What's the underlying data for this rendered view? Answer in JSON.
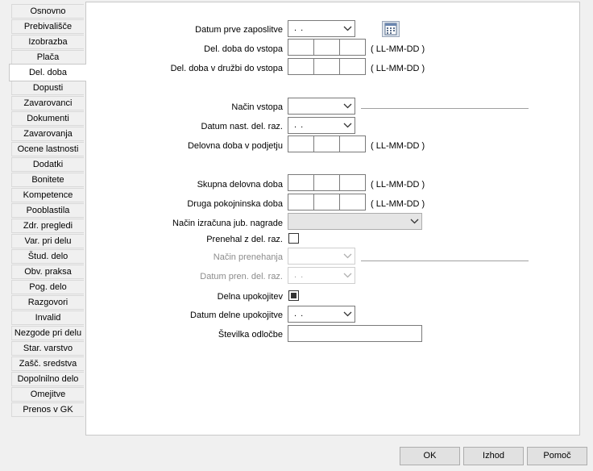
{
  "tabs": [
    {
      "label": "Osnovno"
    },
    {
      "label": "Prebivališče"
    },
    {
      "label": "Izobrazba"
    },
    {
      "label": "Plača"
    },
    {
      "label": "Del. doba",
      "active": true
    },
    {
      "label": "Dopusti"
    },
    {
      "label": "Zavarovanci"
    },
    {
      "label": "Dokumenti"
    },
    {
      "label": "Zavarovanja"
    },
    {
      "label": "Ocene lastnosti"
    },
    {
      "label": "Dodatki"
    },
    {
      "label": "Bonitete"
    },
    {
      "label": "Kompetence"
    },
    {
      "label": "Pooblastila"
    },
    {
      "label": "Zdr. pregledi"
    },
    {
      "label": "Var. pri delu"
    },
    {
      "label": "Štud. delo"
    },
    {
      "label": "Obv. praksa"
    },
    {
      "label": "Pog. delo"
    },
    {
      "label": "Razgovori"
    },
    {
      "label": "Invalid"
    },
    {
      "label": "Nezgode pri delu"
    },
    {
      "label": "Star. varstvo"
    },
    {
      "label": "Zašč. sredstva"
    },
    {
      "label": "Dopolnilno delo"
    },
    {
      "label": "Omejitve"
    },
    {
      "label": "Prenos v GK"
    }
  ],
  "form": {
    "datum_prve_zaposlitve": {
      "label": "Datum prve zaposlitve",
      "value": ". ."
    },
    "del_doba_do_vstopa": {
      "label": "Del. doba do vstopa",
      "format": "( LL-MM-DD )"
    },
    "del_doba_druzbi": {
      "label": "Del. doba v družbi do vstopa",
      "format": "( LL-MM-DD )"
    },
    "nacin_vstopa": {
      "label": "Način vstopa",
      "value": ""
    },
    "datum_nast": {
      "label": "Datum nast. del. raz.",
      "value": ". ."
    },
    "delovna_doba_podjetju": {
      "label": "Delovna doba v podjetju",
      "format": "( LL-MM-DD )"
    },
    "skupna_delovna_doba": {
      "label": "Skupna delovna doba",
      "format": "( LL-MM-DD )"
    },
    "druga_pokojninska_doba": {
      "label": "Druga pokojninska doba",
      "format": "( LL-MM-DD )"
    },
    "nacin_izracuna": {
      "label": "Način izračuna jub. nagrade",
      "value": ""
    },
    "prenehal": {
      "label": "Prenehal z del. raz.",
      "checked": false
    },
    "nacin_prenehanja": {
      "label": "Način prenehanja",
      "value": ""
    },
    "datum_pren": {
      "label": "Datum pren. del. raz.",
      "value": ". ."
    },
    "delna_upokojitev": {
      "label": "Delna upokojitev",
      "checked": true
    },
    "datum_delne": {
      "label": "Datum delne upokojitve",
      "value": ". ."
    },
    "stevilka_odlocbe": {
      "label": "Številka odločbe",
      "value": ""
    }
  },
  "buttons": {
    "ok": "OK",
    "izhod": "Izhod",
    "pomoc": "Pomoč"
  },
  "icons": {
    "calendar": "calendar-icon",
    "dropdown": "chevron-down-icon"
  }
}
